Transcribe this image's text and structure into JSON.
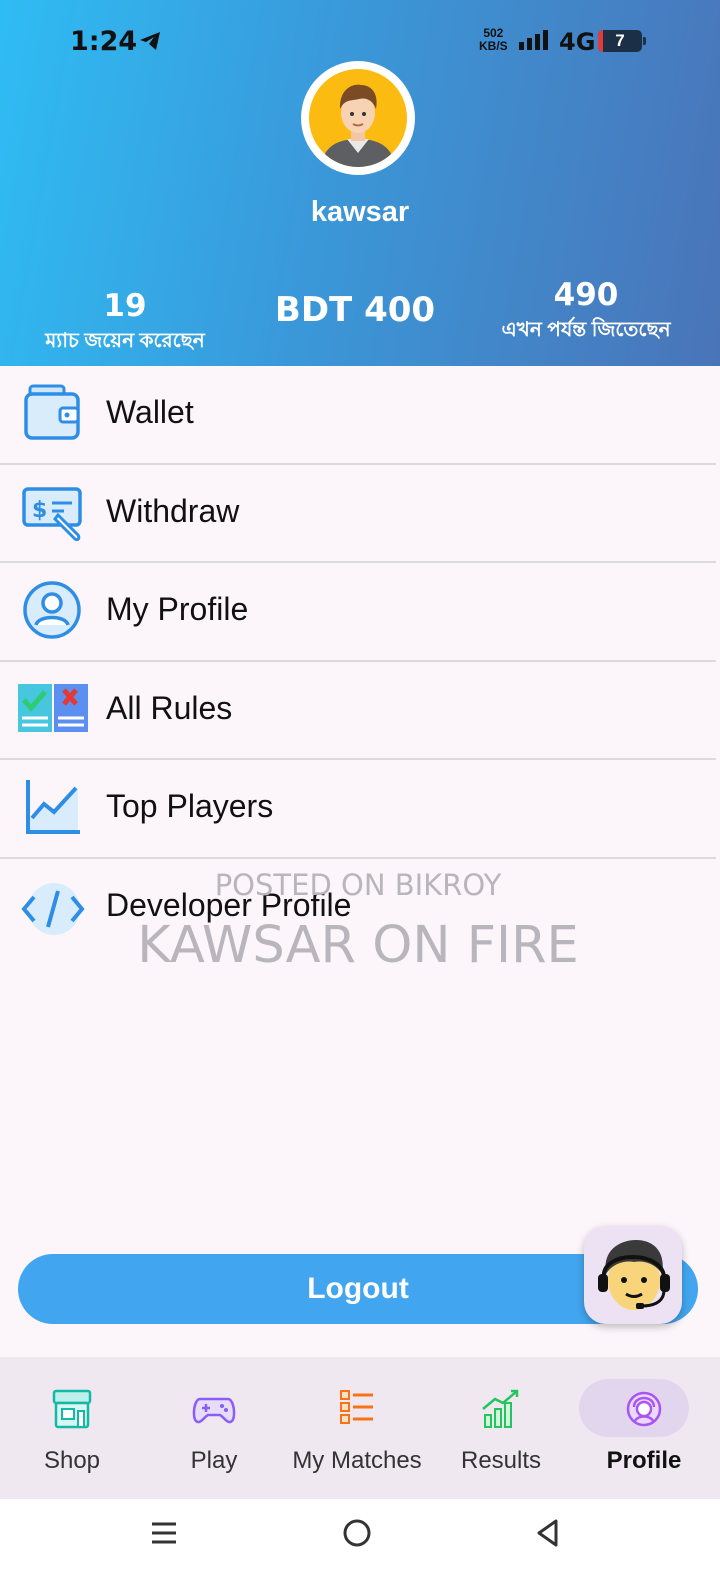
{
  "status_bar": {
    "time": "1:24",
    "speed_value": "502",
    "speed_unit": "KB/S",
    "network": "4G",
    "battery": "7"
  },
  "profile": {
    "username": "kawsar",
    "matches_joined": "19",
    "matches_joined_label": "ম্যাচ জয়েন করেছেন",
    "balance": "BDT 400",
    "total_won": "490",
    "total_won_label": "এখন পর্যন্ত জিতেছেন"
  },
  "menu": {
    "items": [
      {
        "label": "Wallet",
        "icon": "wallet-icon"
      },
      {
        "label": "Withdraw",
        "icon": "withdraw-icon"
      },
      {
        "label": "My Profile",
        "icon": "user-profile-icon"
      },
      {
        "label": "All Rules",
        "icon": "rules-icon"
      },
      {
        "label": "Top Players",
        "icon": "chart-icon"
      },
      {
        "label": "Developer Profile",
        "icon": "code-icon"
      }
    ]
  },
  "watermark": {
    "line1": "POSTED ON BIKROY",
    "line2": "KAWSAR ON FIRE"
  },
  "logout_label": "Logout",
  "bottom_nav": {
    "items": [
      {
        "label": "Shop",
        "icon": "shop-icon",
        "active": false
      },
      {
        "label": "Play",
        "icon": "gamepad-icon",
        "active": false
      },
      {
        "label": "My Matches",
        "icon": "list-icon",
        "active": false
      },
      {
        "label": "Results",
        "icon": "results-chart-icon",
        "active": false
      },
      {
        "label": "Profile",
        "icon": "profile-icon",
        "active": true
      }
    ]
  },
  "colors": {
    "header_gradient_start": "#2fbcf4",
    "header_gradient_end": "#4a74b8",
    "logout_button": "#42a5ef",
    "active_nav_pill": "#e2d6ef"
  }
}
